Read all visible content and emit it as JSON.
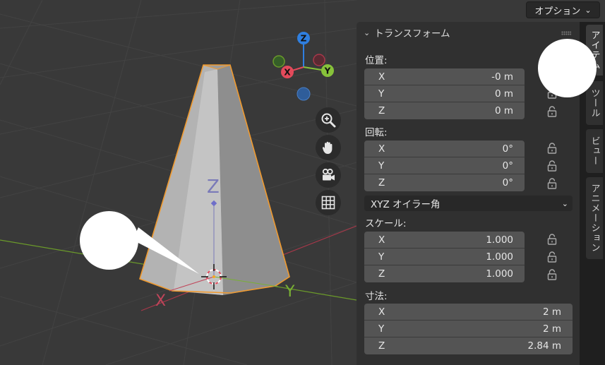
{
  "header": {
    "options_label": "オプション"
  },
  "gizmo": {
    "z": "Z",
    "y": "Y",
    "x": "X"
  },
  "viewport_labels": {
    "z_axis": "Z",
    "x_axis": "X",
    "y_axis": "Y"
  },
  "panel": {
    "title": "トランスフォーム",
    "location": {
      "label": "位置:",
      "rows": [
        {
          "axis": "X",
          "value": "-0 m"
        },
        {
          "axis": "Y",
          "value": "0 m"
        },
        {
          "axis": "Z",
          "value": "0 m"
        }
      ]
    },
    "rotation": {
      "label": "回転:",
      "rows": [
        {
          "axis": "X",
          "value": "0°"
        },
        {
          "axis": "Y",
          "value": "0°"
        },
        {
          "axis": "Z",
          "value": "0°"
        }
      ]
    },
    "rotation_mode": "XYZ オイラー角",
    "scale": {
      "label": "スケール:",
      "rows": [
        {
          "axis": "X",
          "value": "1.000"
        },
        {
          "axis": "Y",
          "value": "1.000"
        },
        {
          "axis": "Z",
          "value": "1.000"
        }
      ]
    },
    "dimensions": {
      "label": "寸法:",
      "rows": [
        {
          "axis": "X",
          "value": "2 m"
        },
        {
          "axis": "Y",
          "value": "2 m"
        },
        {
          "axis": "Z",
          "value": "2.84 m"
        }
      ]
    }
  },
  "tabs": [
    "アイテム",
    "ツール",
    "ビュー",
    "アニメーション"
  ],
  "colors": {
    "x_axis": "#e34a5b",
    "y_axis": "#87c23a",
    "z_axis": "#2f7fe0",
    "selection": "#f5a623"
  }
}
